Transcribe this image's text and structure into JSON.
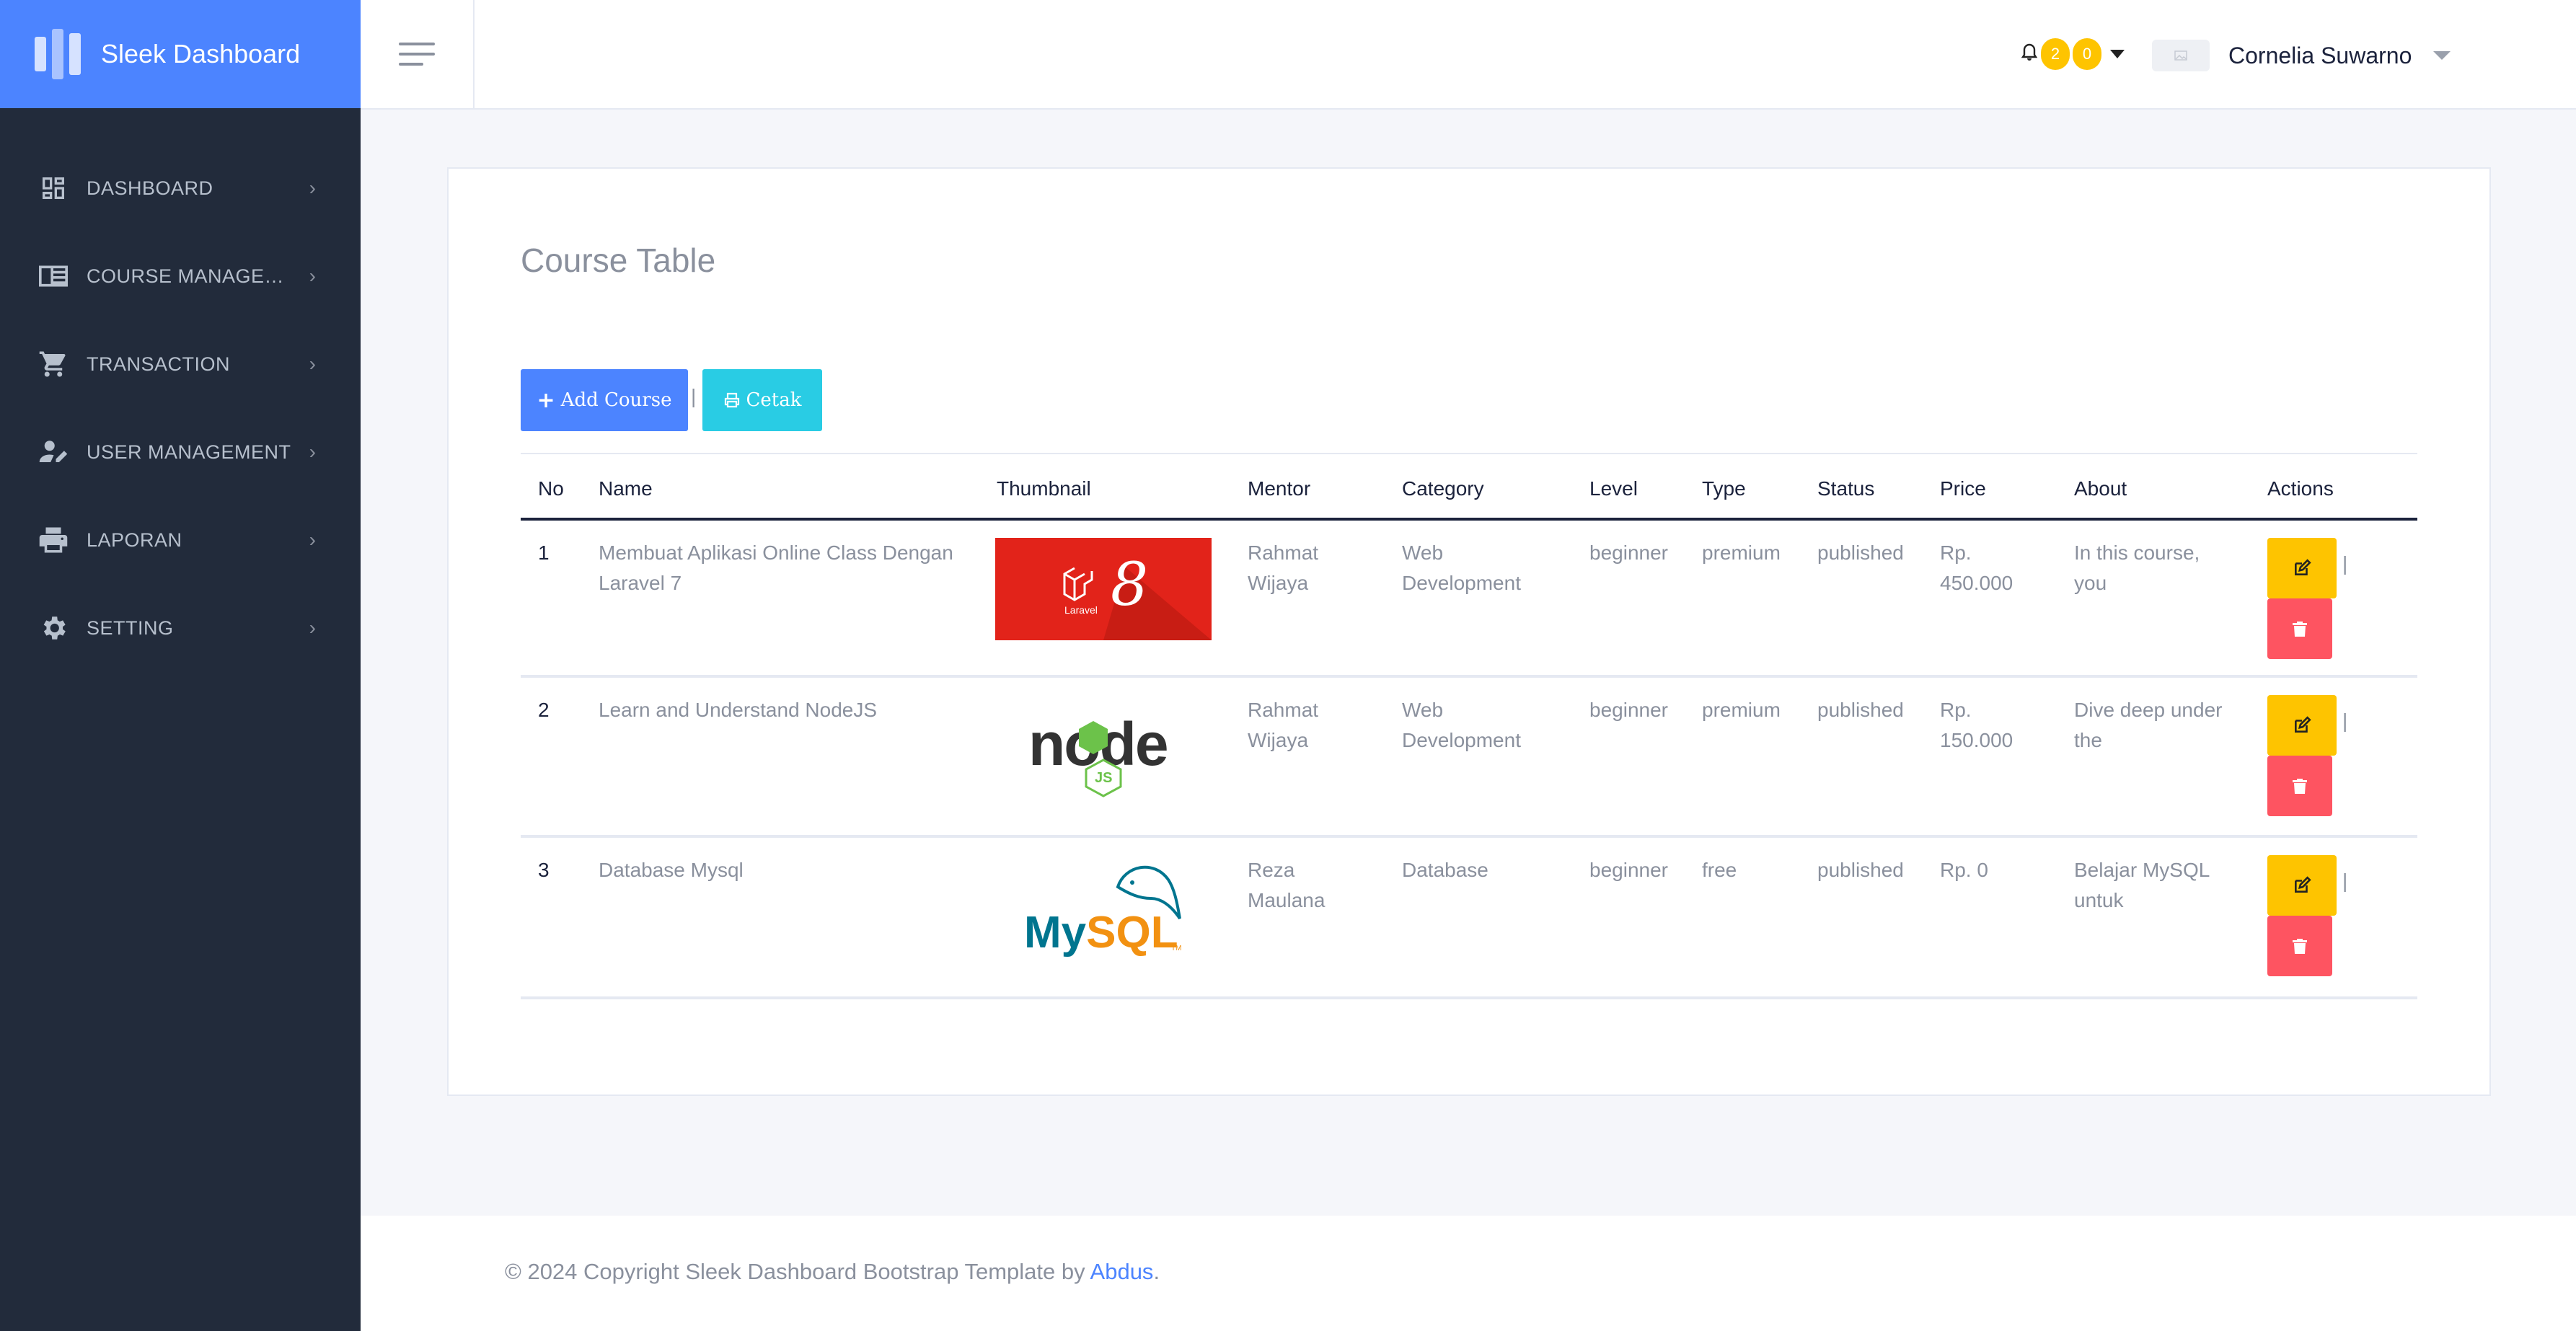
{
  "brand": {
    "title": "Sleek Dashboard"
  },
  "sidebar": {
    "items": [
      {
        "label": "DASHBOARD",
        "icon": "dashboard-icon"
      },
      {
        "label": "COURSE MANAGEMENT",
        "icon": "course-icon"
      },
      {
        "label": "TRANSACTION",
        "icon": "cart-icon"
      },
      {
        "label": "USER MANAGEMENT",
        "icon": "user-edit-icon"
      },
      {
        "label": "LAPORAN",
        "icon": "printer-icon"
      },
      {
        "label": "SETTING",
        "icon": "gear-icon"
      }
    ]
  },
  "header": {
    "badges": [
      "2",
      "0"
    ],
    "user_name": "Cornelia Suwarno"
  },
  "card": {
    "title": "Course Table",
    "add_label": "Add Course",
    "print_label": "Cetak",
    "separator": "|"
  },
  "table": {
    "columns": [
      "No",
      "Name",
      "Thumbnail",
      "Mentor",
      "Category",
      "Level",
      "Type",
      "Status",
      "Price",
      "About",
      "Actions"
    ],
    "rows": [
      {
        "no": "1",
        "name": "Membuat Aplikasi Online Class Dengan Laravel 7",
        "thumbnail": "Laravel 8",
        "thumb_caption": "Laravel",
        "thumb_big": "8",
        "mentor": "Rahmat Wijaya",
        "category": "Web Development",
        "level": "beginner",
        "type": "premium",
        "status": "published",
        "price": "Rp. 450.000",
        "about": "In this course, you"
      },
      {
        "no": "2",
        "name": "Learn and Understand NodeJS",
        "thumbnail": "node",
        "thumb_caption": "JS",
        "thumb_big": "node",
        "mentor": "Rahmat Wijaya",
        "category": "Web Development",
        "level": "beginner",
        "type": "premium",
        "status": "published",
        "price": "Rp. 150.000",
        "about": "Dive deep under the"
      },
      {
        "no": "3",
        "name": "Database Mysql",
        "thumbnail": "MySQL",
        "thumb_caption": "TM",
        "thumb_big": "MySQL",
        "mentor": "Reza Maulana",
        "category": "Database",
        "level": "beginner",
        "type": "free",
        "status": "published",
        "price": "Rp. 0",
        "about": "Belajar MySQL untuk"
      }
    ]
  },
  "footer": {
    "text": "© 2024 Copyright Sleek Dashboard Bootstrap Template by ",
    "link": "Abdus",
    "suffix": "."
  },
  "colors": {
    "primary": "#4c84ff",
    "sidebar": "#222b3b",
    "info": "#29cce4",
    "warning": "#fec400",
    "danger": "#fe5461"
  }
}
